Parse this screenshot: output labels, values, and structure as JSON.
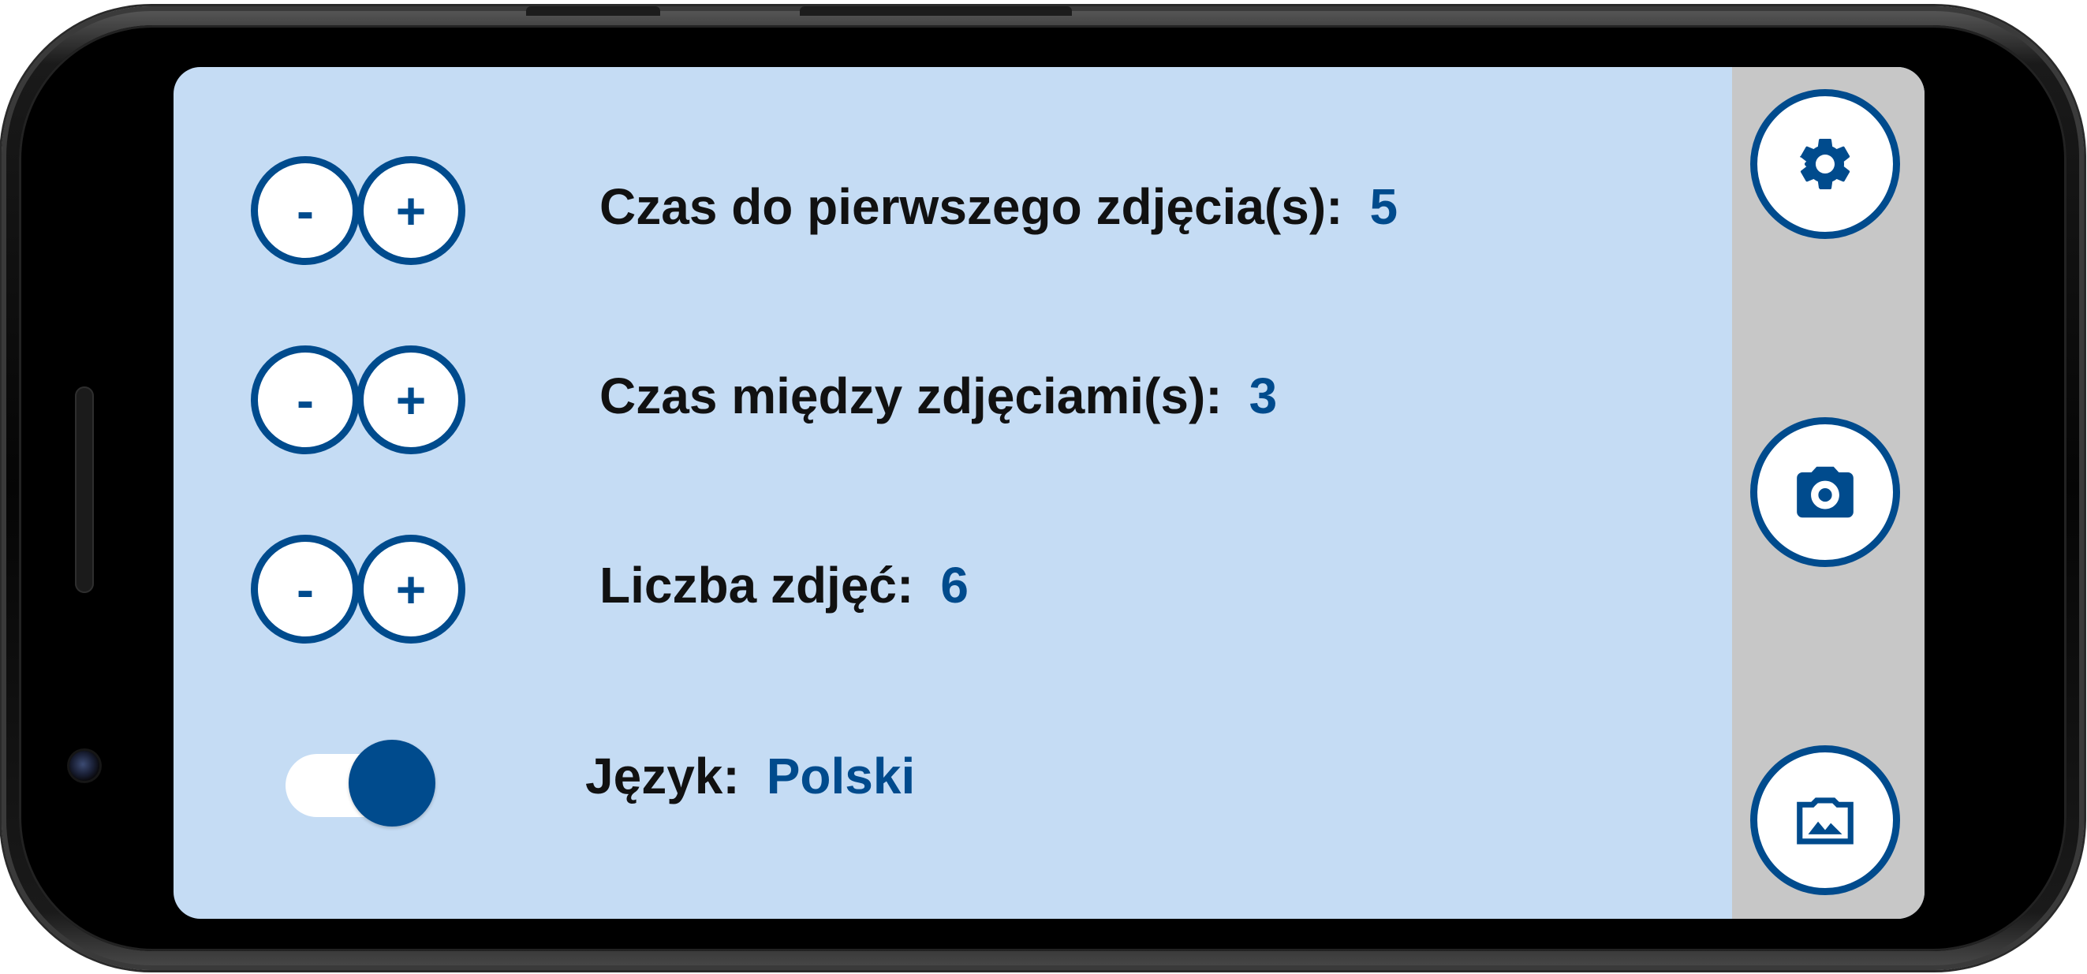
{
  "settings": {
    "first_photo_delay": {
      "label": "Czas do pierwszego zdjęcia(s):",
      "value": "5",
      "decrement": "-",
      "increment": "+"
    },
    "interval": {
      "label": "Czas między zdjęciami(s):",
      "value": "3",
      "decrement": "-",
      "increment": "+"
    },
    "photo_count": {
      "label": "Liczba zdjęć:",
      "value": "6",
      "decrement": "-",
      "increment": "+"
    },
    "language": {
      "label": "Język:",
      "value": "Polski",
      "toggle_on": true
    }
  },
  "side_actions": {
    "settings_icon": "gear-icon",
    "camera_icon": "camera-icon",
    "gallery_icon": "gallery-icon"
  },
  "colors": {
    "accent": "#004b8d",
    "screen_bg": "#c5dcf4",
    "side_panel_bg": "#c7c7c7",
    "label_text": "#111111"
  }
}
